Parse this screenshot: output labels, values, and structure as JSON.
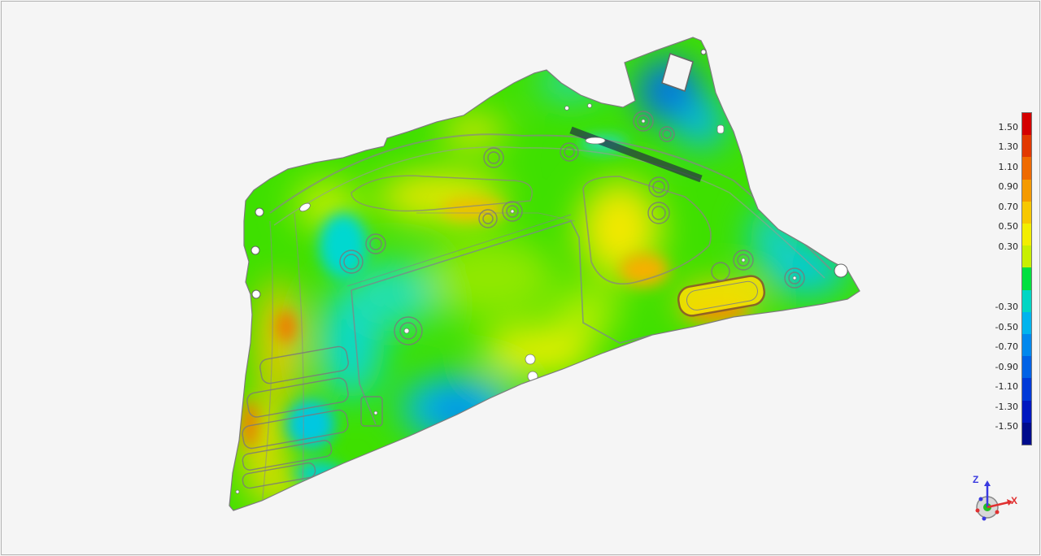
{
  "viewer": {
    "kind": "deviation color map"
  },
  "legend": {
    "labels": [
      "1.50",
      "1.30",
      "1.10",
      "0.90",
      "0.70",
      "0.50",
      "0.30",
      "-0.30",
      "-0.50",
      "-0.70",
      "-0.90",
      "-1.10",
      "-1.30",
      "-1.50"
    ],
    "colors": [
      "#d40000",
      "#e23800",
      "#ef6a00",
      "#f59a00",
      "#f7c800",
      "#f2ee00",
      "#c8ef00",
      "#00e040",
      "#00d6c4",
      "#00b4ee",
      "#0088ee",
      "#0062e6",
      "#003ad8",
      "#0018c0",
      "#000c8c"
    ]
  },
  "triad": {
    "x_label": "X",
    "z_label": "Z"
  }
}
